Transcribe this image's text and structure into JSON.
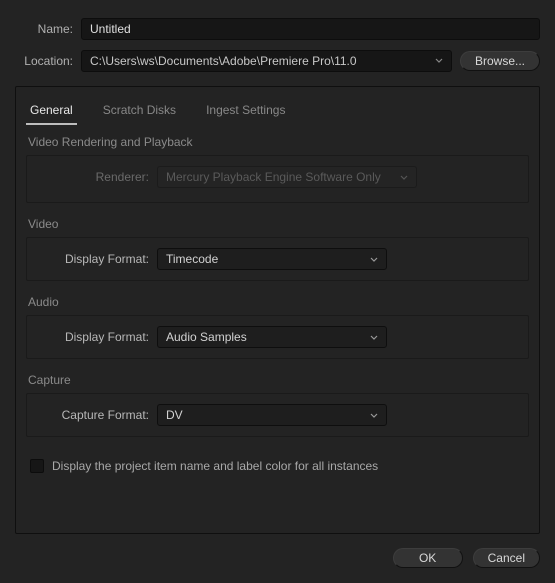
{
  "header": {
    "name_label": "Name:",
    "name_value": "Untitled",
    "location_label": "Location:",
    "location_value": "C:\\Users\\ws\\Documents\\Adobe\\Premiere Pro\\11.0",
    "browse_label": "Browse..."
  },
  "tabs": {
    "general": "General",
    "scratch": "Scratch Disks",
    "ingest": "Ingest Settings"
  },
  "groups": {
    "rendering": {
      "title": "Video Rendering and Playback",
      "renderer_label": "Renderer:",
      "renderer_value": "Mercury Playback Engine Software Only"
    },
    "video": {
      "title": "Video",
      "display_format_label": "Display Format:",
      "display_format_value": "Timecode"
    },
    "audio": {
      "title": "Audio",
      "display_format_label": "Display Format:",
      "display_format_value": "Audio Samples"
    },
    "capture": {
      "title": "Capture",
      "capture_format_label": "Capture Format:",
      "capture_format_value": "DV"
    }
  },
  "checkbox": {
    "label": "Display the project item name and label color for all instances",
    "checked": false
  },
  "footer": {
    "ok": "OK",
    "cancel": "Cancel"
  }
}
